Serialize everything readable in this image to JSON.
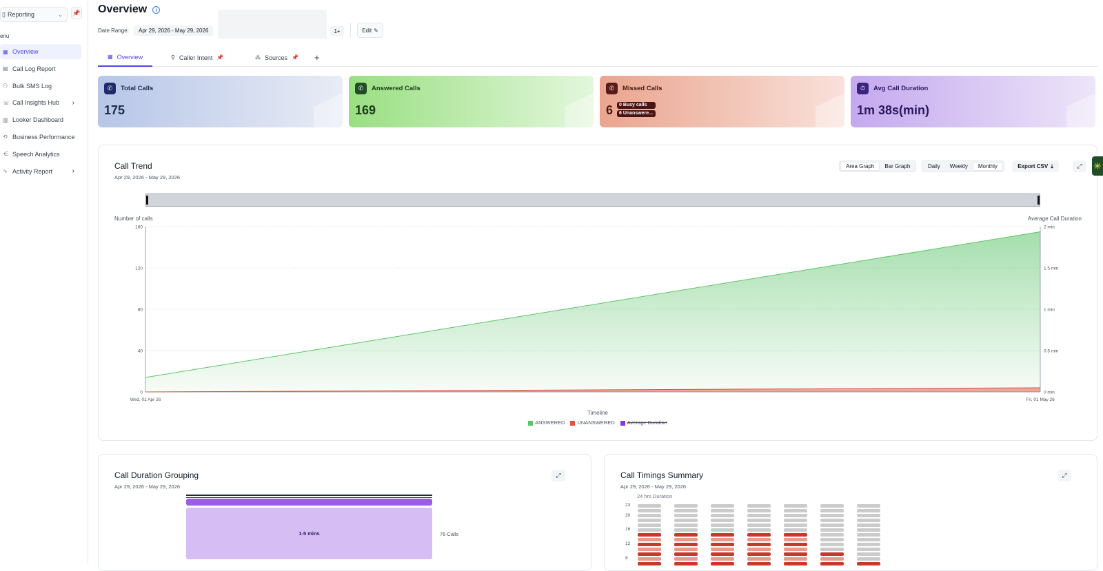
{
  "sidebar": {
    "workspace": "Reporting",
    "menu_label": "enu",
    "items": [
      {
        "label": "Overview",
        "icon": "grid-icon",
        "active": true
      },
      {
        "label": "Call Log Report",
        "icon": "doc-icon"
      },
      {
        "label": "Bulk SMS Log",
        "icon": "users-icon"
      },
      {
        "label": "Call Insights Hub",
        "icon": "insights-icon",
        "arrow": "›"
      },
      {
        "label": "Looker Dashboard",
        "icon": "dashboard-icon"
      },
      {
        "label": "Business Performance",
        "icon": "performance-icon"
      },
      {
        "label": "Speech Analytics",
        "icon": "speech-icon"
      },
      {
        "label": "Activity Report",
        "icon": "activity-icon",
        "arrow": "›"
      }
    ]
  },
  "header": {
    "title": "Overview",
    "date_range_label": "Date Range:",
    "date_range_value": "Apr 29, 2026 - May 29, 2026",
    "more_badge": "1+",
    "edit_label": "Edit"
  },
  "tabs": [
    {
      "label": "Overview",
      "icon": "grid-icon",
      "active": true
    },
    {
      "label": "Caller Intent",
      "icon": "intent-icon",
      "pinned": true
    },
    {
      "label": "Sources",
      "icon": "sources-icon",
      "pinned": true
    }
  ],
  "kpis": {
    "total": {
      "label": "Total Calls",
      "value": "175"
    },
    "answered": {
      "label": "Answered Calls",
      "value": "169"
    },
    "missed": {
      "label": "Missed Calls",
      "value": "6",
      "badge1": "0 Busy calls",
      "badge2": "6 Unanswere..."
    },
    "duration": {
      "label": "Avg Call Duration",
      "value": "1m 38s(min)"
    }
  },
  "call_trend": {
    "title": "Call Trend",
    "subtitle": "Apr 29, 2026 - May 29, 2026",
    "graph_toggle": [
      "Area Graph",
      "Bar Graph"
    ],
    "period_toggle": [
      "Daily",
      "Weekly",
      "Monthly"
    ],
    "export_label": "Export CSV"
  },
  "chart_data": {
    "type": "area",
    "x": [
      "Wed, 01 Apr 26",
      "Fri, 01 May 26"
    ],
    "xlabel": "Timeline",
    "ylabel": "Number of calls",
    "y2label": "Average Call Duration",
    "ylim": [
      0,
      160
    ],
    "yticks": [
      0,
      40,
      80,
      120,
      160
    ],
    "y2ticks": [
      "0 min",
      "0.5 min",
      "1 min",
      "1.5 min",
      "2 min"
    ],
    "series": [
      {
        "name": "ANSWERED",
        "values": [
          14,
          155
        ],
        "color": "#5cc46a"
      },
      {
        "name": "UNANSWERED",
        "values": [
          0,
          4
        ],
        "color": "#e0533d"
      },
      {
        "name": "Average Duration",
        "values": [],
        "color": "#7c3aed",
        "hidden": true
      }
    ],
    "grid": true,
    "legend_position": "bottom"
  },
  "duration_grouping": {
    "title": "Call Duration Grouping",
    "subtitle": "Apr 29, 2026 - May 29, 2026",
    "segment_label": "1-5 mins",
    "segment_count": "76 Calls"
  },
  "timings": {
    "title": "Call Timings Summary",
    "subtitle": "Apr 29, 2026 - May 29, 2026",
    "caption": "24 hrs Duration",
    "hour_ticks": [
      "23",
      "20",
      "16",
      "12",
      "8"
    ]
  },
  "colors": {
    "accent": "#4f46e5",
    "answered": "#5cc46a",
    "unanswered": "#e0533d",
    "duration": "#7c3aed"
  }
}
